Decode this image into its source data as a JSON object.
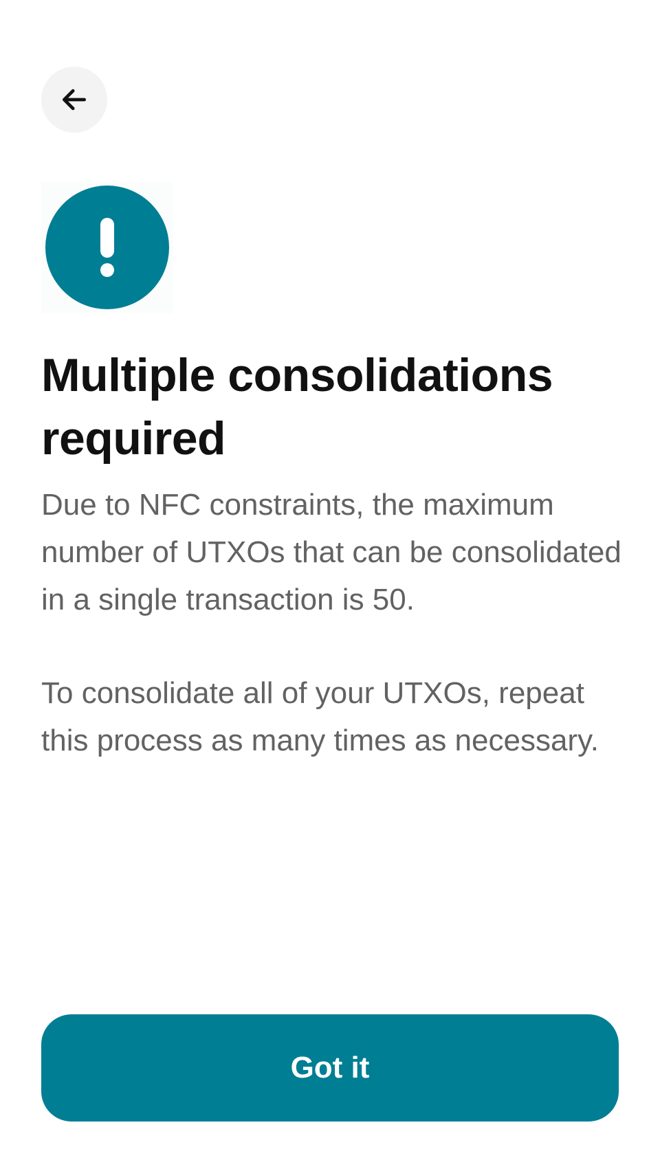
{
  "navigation": {
    "back_icon": "arrow-left-icon"
  },
  "alert": {
    "icon": "exclamation-icon",
    "color": "#007E94"
  },
  "content": {
    "title": "Multiple consolidations required",
    "paragraph_1": "Due to NFC constraints, the maximum number of UTXOs that can be consolidated in a single transaction is 50.",
    "paragraph_2": "To consolidate all of your UTXOs, repeat this process as many times as necessary."
  },
  "actions": {
    "primary_label": "Got it",
    "primary_color": "#007E94"
  }
}
